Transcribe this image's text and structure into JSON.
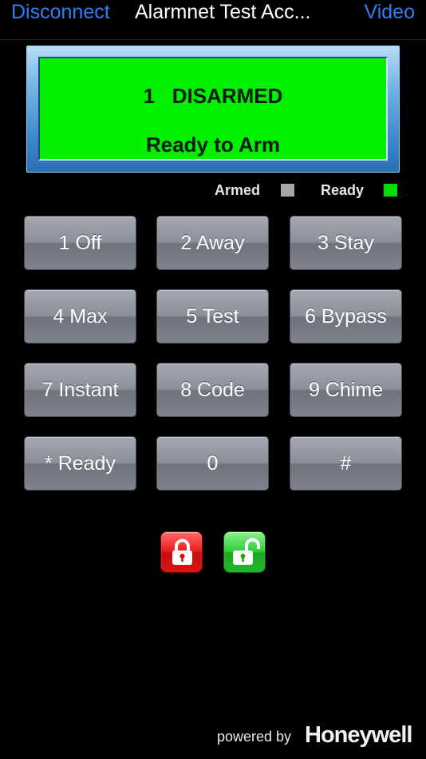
{
  "navbar": {
    "left_label": "Disconnect",
    "title": "Alarmnet Test Acc...",
    "right_label": "Video"
  },
  "display": {
    "line1": "1   DISARMED",
    "line2": "Ready to Arm",
    "background_color": "#00f000"
  },
  "status": {
    "armed_label": "Armed",
    "armed_color": "#a6a6a6",
    "ready_label": "Ready",
    "ready_color": "#00e000"
  },
  "keypad": {
    "keys": [
      {
        "label": "1 Off"
      },
      {
        "label": "2 Away"
      },
      {
        "label": "3 Stay"
      },
      {
        "label": "4 Max"
      },
      {
        "label": "5 Test"
      },
      {
        "label": "6 Bypass"
      },
      {
        "label": "7 Instant"
      },
      {
        "label": "8 Code"
      },
      {
        "label": "9 Chime"
      },
      {
        "label": "* Ready"
      },
      {
        "label": "0"
      },
      {
        "label": "#"
      }
    ]
  },
  "lock_buttons": {
    "lock": {
      "icon": "lock-closed-icon",
      "color": "#e81c1c"
    },
    "unlock": {
      "icon": "lock-open-icon",
      "color": "#2fcf3a"
    }
  },
  "footer": {
    "powered_by": "powered by",
    "brand": "Honeywell"
  }
}
